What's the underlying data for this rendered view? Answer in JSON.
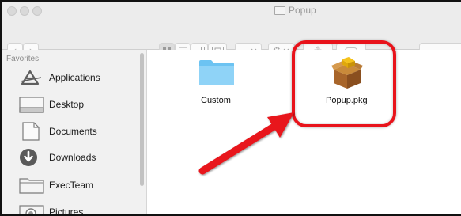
{
  "window": {
    "title": "Popup"
  },
  "toolbar": {
    "back_glyph": "‹",
    "forward_glyph": "›",
    "view_icon": "⊞ grid",
    "list_icon": "list",
    "column_icon": "columns",
    "gallery_icon": "gallery",
    "arrange_icon": "arrange",
    "action_icon": "gear"
  },
  "sidebar": {
    "heading": "Favorites",
    "items": [
      {
        "label": "Applications",
        "icon": "applications-icon"
      },
      {
        "label": "Desktop",
        "icon": "desktop-icon"
      },
      {
        "label": "Documents",
        "icon": "documents-icon"
      },
      {
        "label": "Downloads",
        "icon": "downloads-icon"
      },
      {
        "label": "ExecTeam",
        "icon": "folder-icon"
      },
      {
        "label": "Pictures",
        "icon": "pictures-icon"
      }
    ]
  },
  "files": [
    {
      "name": "Custom",
      "type": "folder"
    },
    {
      "name": "Popup.pkg",
      "type": "package"
    }
  ],
  "annotation": {
    "color": "#e8131b",
    "target": "Popup.pkg"
  }
}
